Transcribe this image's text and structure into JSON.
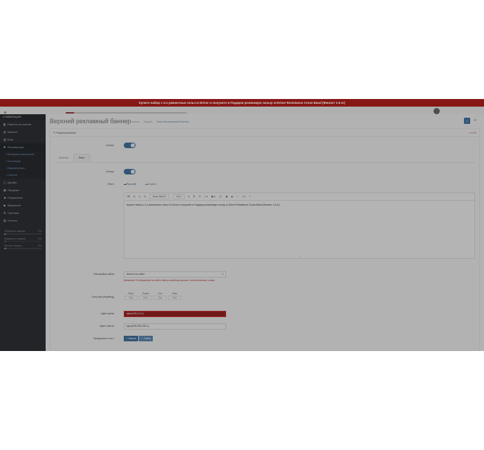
{
  "promo": {
    "text": "Купите набор с 4-х ремонтных гильз U-Driver и получите в Подарок резиновую гильзу U-Driver Resistance Cross Band (Фиолет 1-6 кг)"
  },
  "sidebar": {
    "nav_head": "НАВИГАЦИЯ",
    "items": [
      {
        "label": "Панель состояния",
        "icon": "◧"
      },
      {
        "label": "Каталог",
        "icon": "▤",
        "chev": "›"
      },
      {
        "label": "Блог",
        "icon": "▥",
        "chev": "›"
      },
      {
        "label": "Расширения",
        "icon": "✚",
        "chev": "›"
      }
    ],
    "sub_items": [
      "Менеджер расширений",
      "Установщик",
      "Модификаторы",
      "События"
    ],
    "items2": [
      {
        "label": "Дизайн",
        "icon": "▢",
        "chev": "›"
      },
      {
        "label": "Продажи",
        "icon": "▦",
        "chev": "›"
      },
      {
        "label": "Покупатели",
        "icon": "☻",
        "chev": "›"
      },
      {
        "label": "Маркетинг",
        "icon": "◆",
        "chev": "›"
      },
      {
        "label": "Система",
        "icon": "⚙",
        "chev": "›"
      },
      {
        "label": "Отчеты",
        "icon": "▨",
        "chev": "›"
      }
    ],
    "stats": [
      {
        "label": "Обработка заказов",
        "value": "0%",
        "fill": 0.05
      },
      {
        "label": "Завершено заказов",
        "value": "0%",
        "fill": 0.05
      },
      {
        "label": "Прочие статусы",
        "value": "0%",
        "fill": 0.05
      }
    ]
  },
  "header": {
    "title": "Верхний рекламный баннер",
    "breadcrumbs": [
      "Главная",
      "Модули",
      "Верхний рекламный баннер"
    ],
    "save_icon": "floppy-icon",
    "back_icon": "back-arrow-icon"
  },
  "panel": {
    "heading": "Редактирование",
    "version": "v 1.0.0"
  },
  "form": {
    "status_label": "Статус",
    "tabs": [
      "Шаблон",
      "Текст"
    ],
    "status2_label": "Статус",
    "text_label": "Текст",
    "lang_tabs": [
      "Русский",
      "English"
    ],
    "toolbar_items": [
      "⌫",
      "B",
      "U",
      "S̶",
      "Sans Serif ▾",
      "14 ▾",
      "A",
      "☰",
      "☷",
      "≡ ▾",
      "▦ ▾",
      "🔗",
      "▣",
      "▶",
      "⛶",
      "</>",
      "?"
    ],
    "editor_text": "Купите набор с 4-х ремонтных гильз U-Driver и получите в Подарок резиновую гильзу U-Driver Resistance Cross Band (Фиолет 1-6 кг)",
    "position_label": "Настройка сайта",
    "position_value": "Шапка на сайте",
    "position_hint": "Внимание! Отображение на сайте сайта в шаблоне должно соответствовать опции.",
    "padding_label": "Отступы (Padding)",
    "padding_cols": [
      "Верх",
      "Право",
      "Низ",
      "Лево"
    ],
    "padding_placeholders": [
      "10px",
      "10px",
      "10px",
      "10px"
    ],
    "bg_label": "Цвет фона",
    "bg_value": "rgba(195,0,0,1)",
    "textcolor_label": "Цвет текста",
    "textcolor_value": "rgba(255,255,255,1)",
    "place_label": "Прикрепить его к",
    "place_buttons": [
      "Шапке",
      "Сайту"
    ]
  },
  "colors": {
    "promo_bg": "#a51d1d",
    "sidebar_bg": "#2a2d31",
    "accent": "#3d6790"
  }
}
